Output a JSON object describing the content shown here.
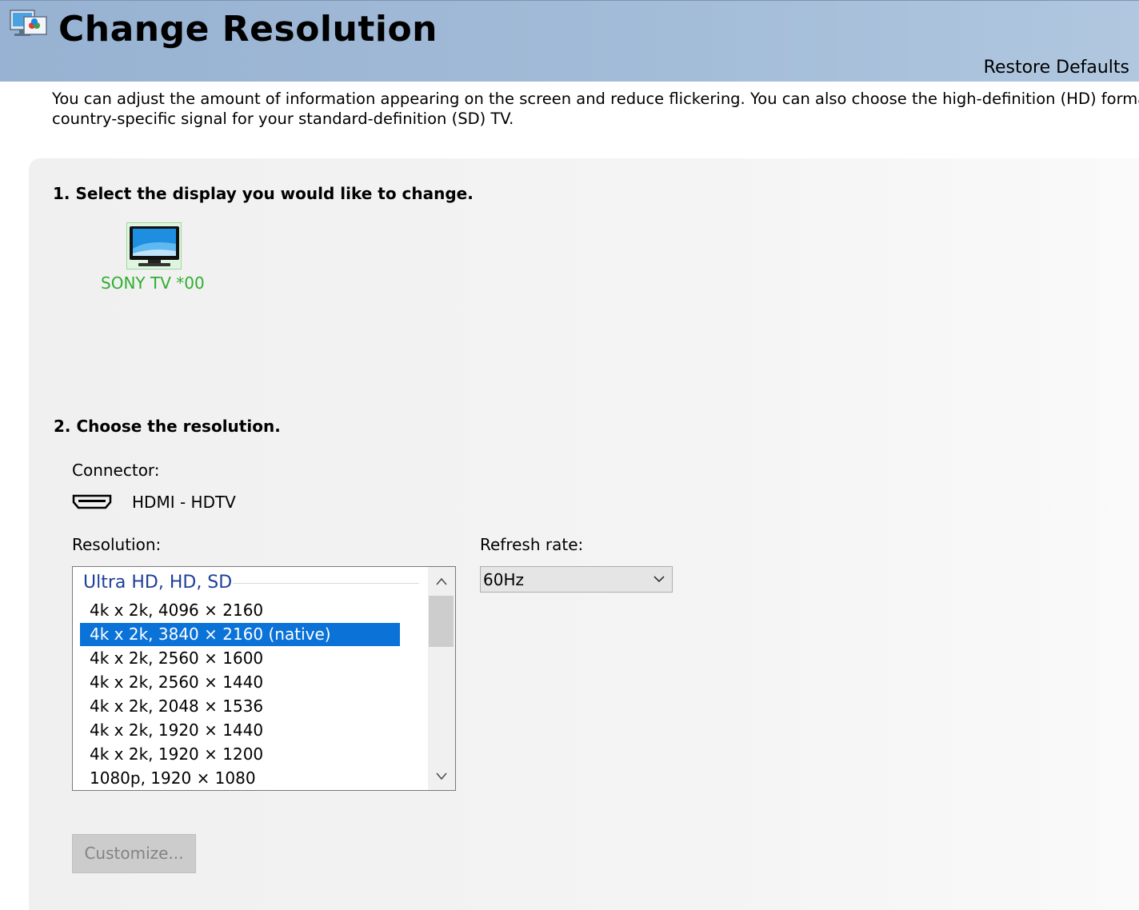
{
  "header": {
    "title": "Change Resolution",
    "restore_defaults": "Restore Defaults",
    "icon": "display-settings-icon"
  },
  "description": {
    "line1": "You can adjust the amount of information appearing on the screen and reduce flickering. You can also choose the high-definition (HD) format it",
    "line2": "country-specific signal for your standard-definition (SD) TV."
  },
  "step1": {
    "title": "1. Select the display you would like to change.",
    "display": {
      "name": "SONY TV  *00",
      "icon": "tv-icon"
    }
  },
  "step2": {
    "title": "2. Choose the resolution.",
    "connector_label": "Connector:",
    "connector_value": "HDMI - HDTV",
    "connector_icon": "hdmi-icon",
    "resolution_label": "Resolution:",
    "refresh_label": "Refresh rate:",
    "resolution_group": "Ultra HD, HD, SD",
    "resolutions": [
      "4k x 2k, 4096 × 2160",
      "4k x 2k, 3840 × 2160 (native)",
      "4k x 2k, 2560 × 1600",
      "4k x 2k, 2560 × 1440",
      "4k x 2k, 2048 × 1536",
      "4k x 2k, 1920 × 1440",
      "4k x 2k, 1920 × 1200",
      "1080p, 1920 × 1080"
    ],
    "selected_resolution": "4k x 2k, 3840 × 2160 (native)",
    "refresh_value": "60Hz",
    "customize_button": "Customize..."
  },
  "colors": {
    "header_bg": "#a3bcd8",
    "selection": "#0b72d7",
    "display_name": "#2fae2f",
    "group_heading": "#1d3e9b"
  }
}
